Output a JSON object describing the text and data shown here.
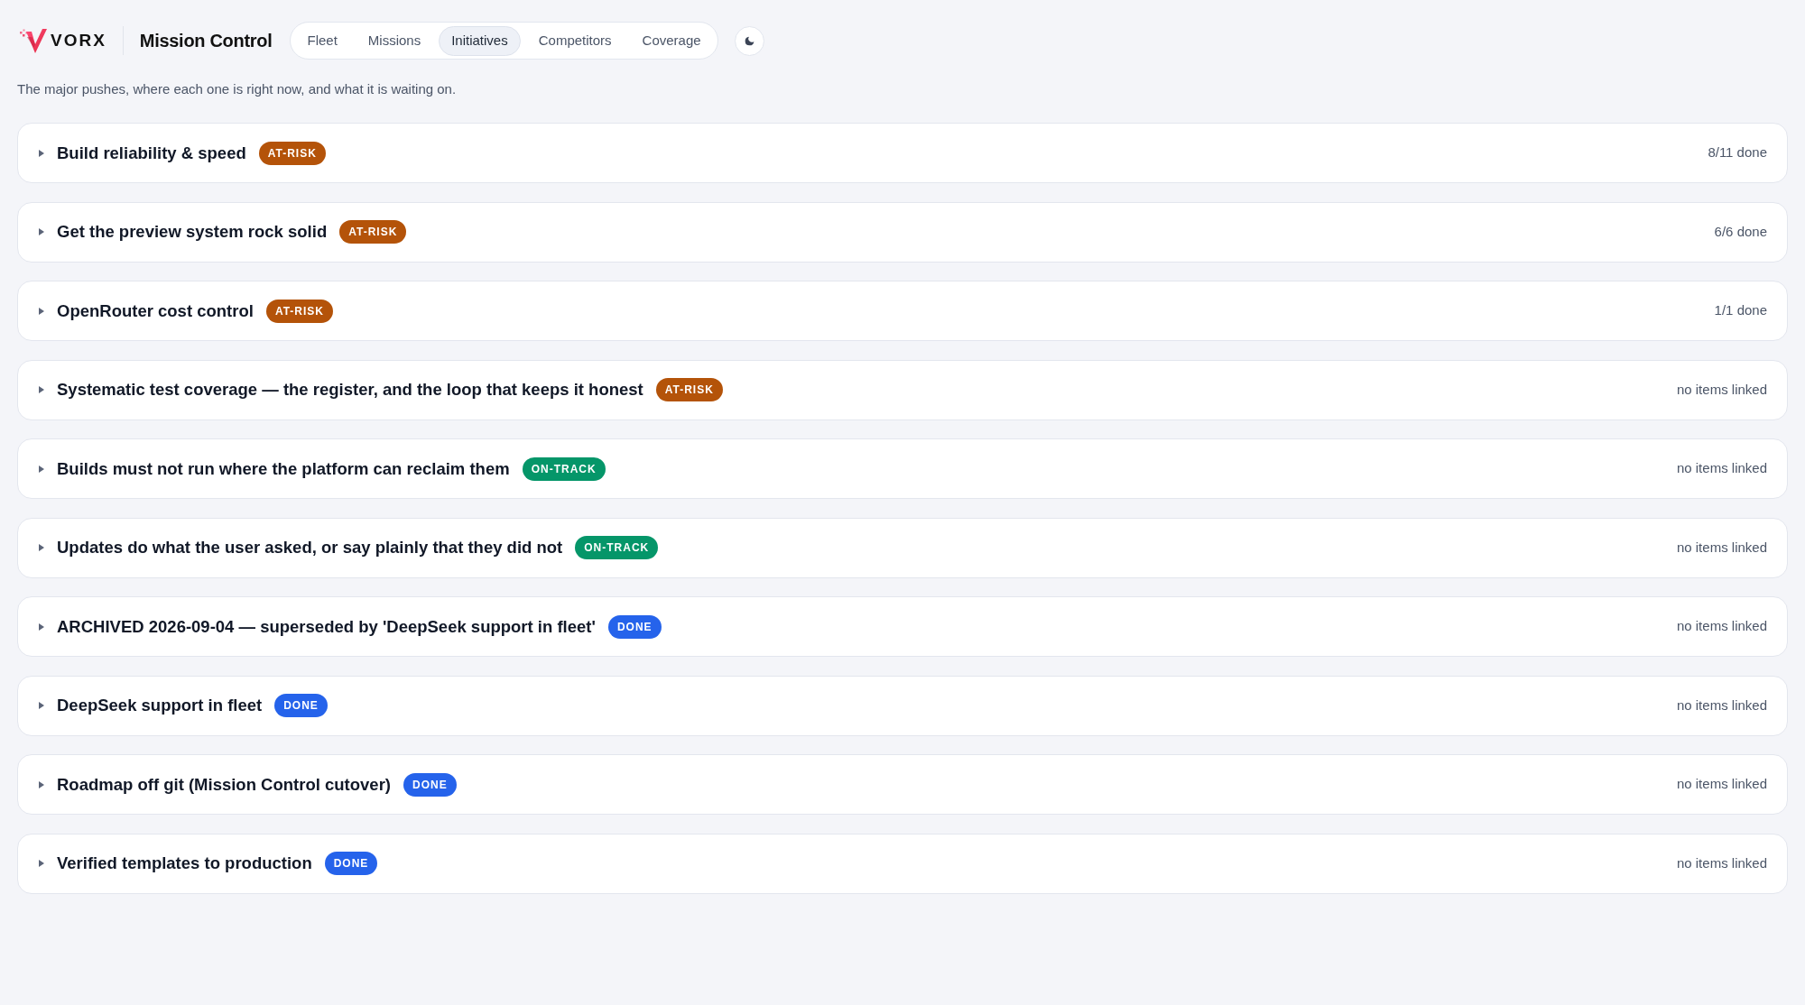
{
  "brand": {
    "name": "VORX"
  },
  "app_title": "Mission Control",
  "tabs": [
    {
      "label": "Fleet",
      "selected": false
    },
    {
      "label": "Missions",
      "selected": false
    },
    {
      "label": "Initiatives",
      "selected": true
    },
    {
      "label": "Competitors",
      "selected": false
    },
    {
      "label": "Coverage",
      "selected": false
    }
  ],
  "subtitle": "The major pushes, where each one is right now, and what it is waiting on.",
  "initiatives": [
    {
      "title": "Build reliability & speed",
      "expanded": false,
      "badge": {
        "label": "AT-RISK",
        "color": "#b45309"
      },
      "progress": "8/11 done"
    },
    {
      "title": "Get the preview system rock solid",
      "expanded": false,
      "badge": {
        "label": "AT-RISK",
        "color": "#b45309"
      },
      "progress": "6/6 done"
    },
    {
      "title": "OpenRouter cost control",
      "expanded": false,
      "badge": {
        "label": "AT-RISK",
        "color": "#b45309"
      },
      "progress": "1/1 done"
    },
    {
      "title": "Systematic test coverage — the register, and the loop that keeps it honest",
      "expanded": false,
      "badge": {
        "label": "AT-RISK",
        "color": "#b45309"
      },
      "progress": "no items linked"
    },
    {
      "title": "Builds must not run where the platform can reclaim them",
      "expanded": false,
      "badge": {
        "label": "ON-TRACK",
        "color": "#059669"
      },
      "progress": "no items linked"
    },
    {
      "title": "Updates do what the user asked, or say plainly that they did not",
      "expanded": false,
      "badge": {
        "label": "ON-TRACK",
        "color": "#059669"
      },
      "progress": "no items linked"
    },
    {
      "title": "ARCHIVED 2026-09-04 — superseded by 'DeepSeek support in fleet'",
      "expanded": false,
      "badge": {
        "label": "DONE",
        "color": "#2563eb"
      },
      "progress": "no items linked"
    },
    {
      "title": "DeepSeek support in fleet",
      "expanded": false,
      "badge": {
        "label": "DONE",
        "color": "#2563eb"
      },
      "progress": "no items linked"
    },
    {
      "title": "Roadmap off git (Mission Control cutover)",
      "expanded": false,
      "badge": {
        "label": "DONE",
        "color": "#2563eb"
      },
      "progress": "no items linked"
    },
    {
      "title": "Verified templates to production",
      "expanded": false,
      "badge": {
        "label": "DONE",
        "color": "#2563eb"
      },
      "progress": "no items linked"
    }
  ]
}
